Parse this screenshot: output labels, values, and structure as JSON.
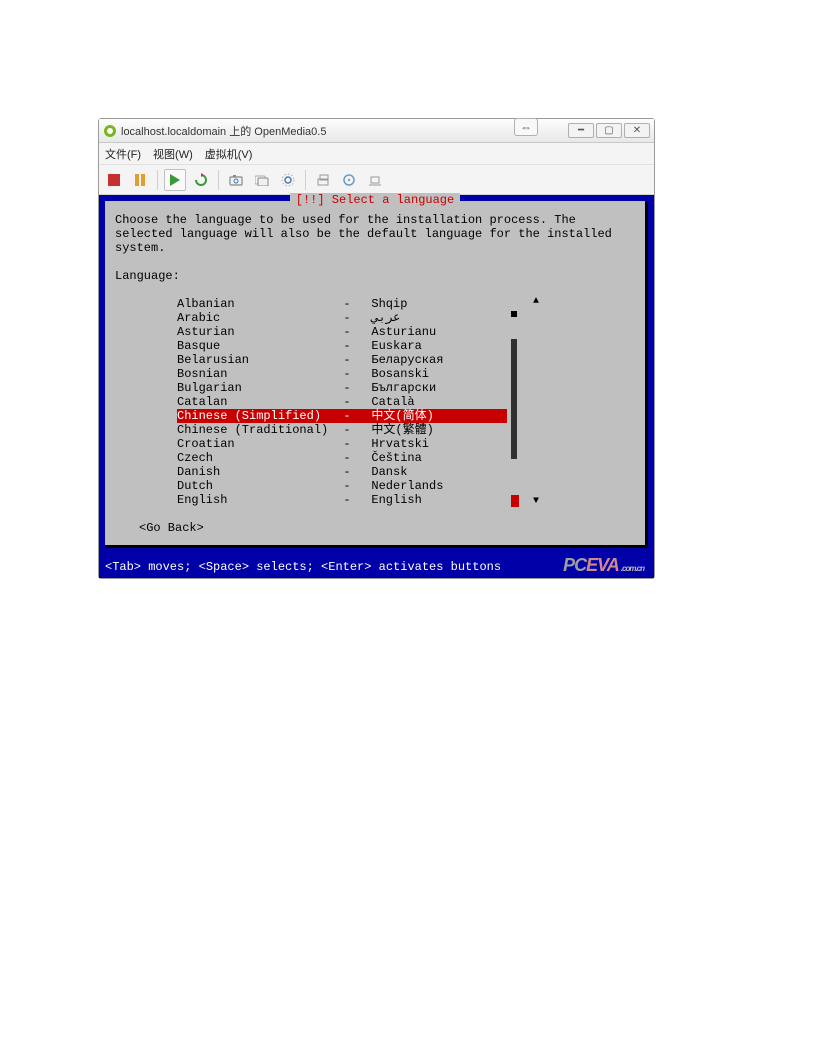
{
  "window_title": "localhost.localdomain 上的 OpenMedia0.5",
  "menubar": {
    "file": "文件(F)",
    "view": "视图(W)",
    "vm": "虚拟机(V)"
  },
  "dialog": {
    "title": "[!!] Select a language",
    "description": "Choose the language to be used for the installation process. The selected language will also be the default language for the installed system.",
    "language_label": "Language:",
    "go_back": "<Go Back>"
  },
  "languages": [
    {
      "name": "Albanian",
      "native": "Shqip",
      "selected": false
    },
    {
      "name": "Arabic",
      "native": "عربي",
      "selected": false
    },
    {
      "name": "Asturian",
      "native": "Asturianu",
      "selected": false
    },
    {
      "name": "Basque",
      "native": "Euskara",
      "selected": false
    },
    {
      "name": "Belarusian",
      "native": "Беларуская",
      "selected": false
    },
    {
      "name": "Bosnian",
      "native": "Bosanski",
      "selected": false
    },
    {
      "name": "Bulgarian",
      "native": "Български",
      "selected": false
    },
    {
      "name": "Catalan",
      "native": "Català",
      "selected": false
    },
    {
      "name": "Chinese (Simplified)",
      "native": "中文(简体)",
      "selected": true
    },
    {
      "name": "Chinese (Traditional)",
      "native": "中文(繁體)",
      "selected": false
    },
    {
      "name": "Croatian",
      "native": "Hrvatski",
      "selected": false
    },
    {
      "name": "Czech",
      "native": "Čeština",
      "selected": false
    },
    {
      "name": "Danish",
      "native": "Dansk",
      "selected": false
    },
    {
      "name": "Dutch",
      "native": "Nederlands",
      "selected": false
    },
    {
      "name": "English",
      "native": "English",
      "selected": false
    }
  ],
  "footer_keys": "<Tab> moves; <Space> selects; <Enter> activates buttons",
  "watermark": {
    "pc": "PC",
    "eva": "EVA",
    "com": ".com.cn"
  },
  "colors": {
    "dialog_bg": "#c0c0c0",
    "blue_bg": "#0000a8",
    "highlight_red": "#c80000"
  }
}
